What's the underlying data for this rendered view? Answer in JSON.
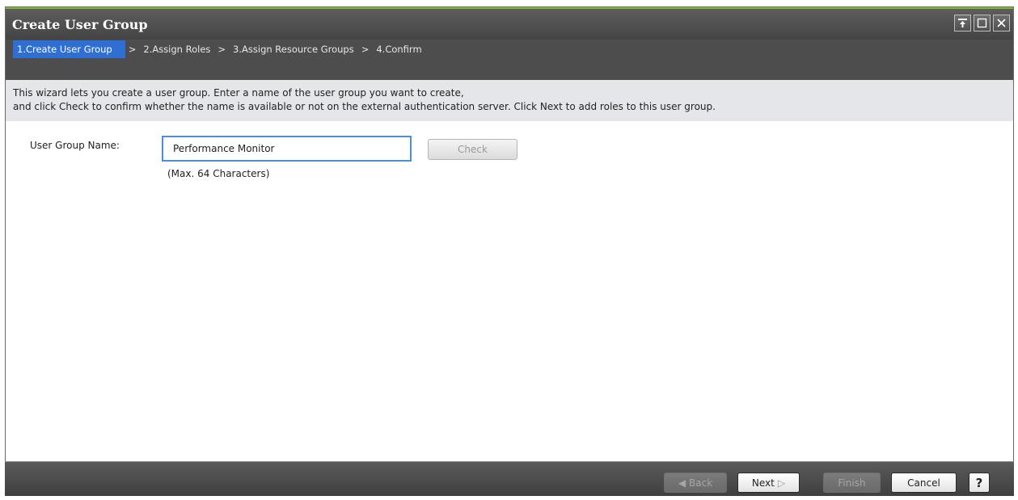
{
  "window": {
    "title": "Create User Group",
    "controls": [
      "pin-icon",
      "maximize-icon",
      "close-icon"
    ]
  },
  "wizard": {
    "steps": [
      {
        "label": "1.Create User Group",
        "active": true
      },
      {
        "label": "2.Assign Roles",
        "active": false
      },
      {
        "label": "3.Assign Resource Groups",
        "active": false
      },
      {
        "label": "4.Confirm",
        "active": false
      }
    ],
    "separator": ">",
    "description_line1": "This wizard lets you create a user group. Enter a name of the user group you want to create,",
    "description_line2": "and click Check to confirm whether the name is available or not on the external authentication server. Click Next to add roles to this user group."
  },
  "form": {
    "name_label": "User Group Name:",
    "name_value": "Performance Monitor",
    "check_label": "Check",
    "hint": "(Max. 64 Characters)"
  },
  "footer": {
    "back_label": "Back",
    "next_label": "Next",
    "finish_label": "Finish",
    "cancel_label": "Cancel",
    "help_label": "?"
  },
  "colors": {
    "accent": "#7bbf2e",
    "active_step": "#2f6fd4",
    "input_focus": "#4a90d9"
  }
}
